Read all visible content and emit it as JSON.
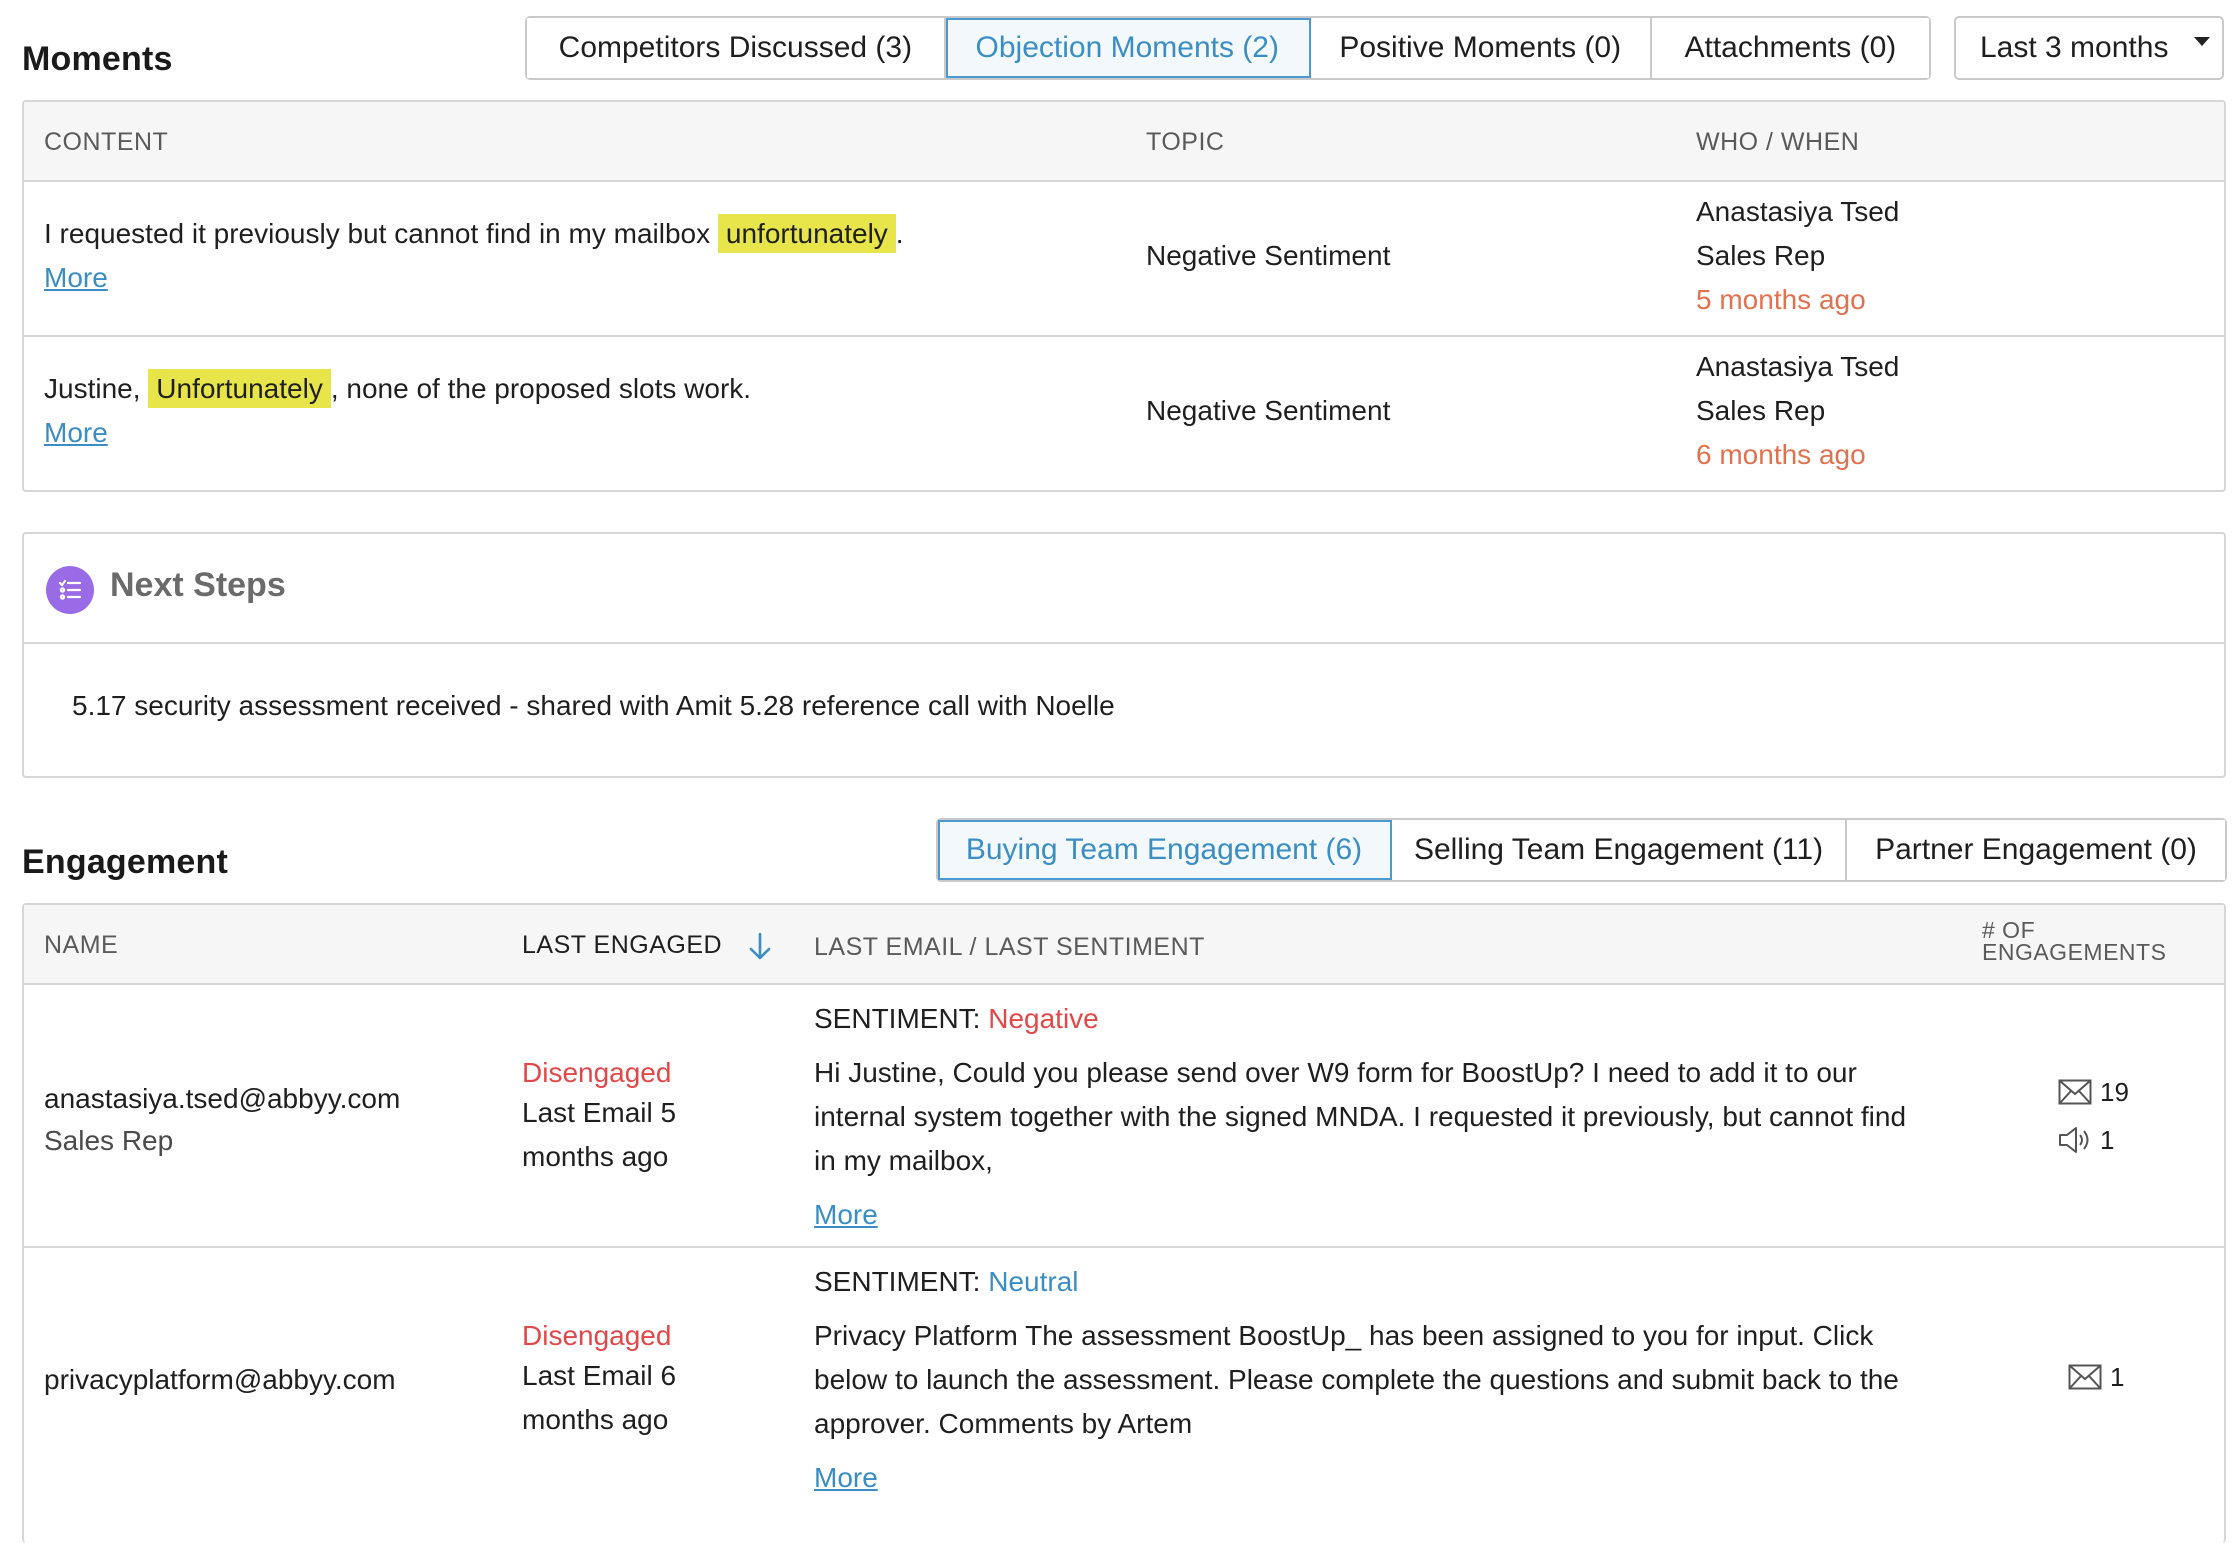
{
  "moments": {
    "title": "Moments",
    "tabs": [
      {
        "label": "Competitors Discussed (3)",
        "active": false
      },
      {
        "label": "Objection Moments (2)",
        "active": true
      },
      {
        "label": "Positive Moments (0)",
        "active": false
      },
      {
        "label": "Attachments (0)",
        "active": false
      }
    ],
    "range_dropdown": "Last 3 months",
    "columns": {
      "content": "CONTENT",
      "topic": "TOPIC",
      "who": "WHO / WHEN"
    },
    "rows": [
      {
        "content_before": "I requested it previously but cannot find in my mailbox ",
        "content_highlight": "unfortunately",
        "content_after": ".",
        "more": "More",
        "topic": "Negative Sentiment",
        "who_name": "Anastasiya Tsed",
        "who_role": "Sales Rep",
        "when": "5 months ago"
      },
      {
        "content_before": "Justine, ",
        "content_highlight": "Unfortunately",
        "content_after": ", none of the proposed slots work.",
        "more": "More",
        "topic": "Negative Sentiment",
        "who_name": "Anastasiya Tsed",
        "who_role": "Sales Rep",
        "when": "6 months ago"
      }
    ]
  },
  "next_steps": {
    "title": "Next Steps",
    "icon": "checklist-icon",
    "icon_color": "#9a6be6",
    "text": "5.17 security assessment received - shared with Amit 5.28 reference call with Noelle"
  },
  "engagement": {
    "title": "Engagement",
    "tabs": [
      {
        "label": "Buying Team Engagement (6)",
        "active": true
      },
      {
        "label": "Selling Team Engagement (11)",
        "active": false
      },
      {
        "label": "Partner Engagement (0)",
        "active": false
      }
    ],
    "columns": {
      "name": "NAME",
      "last_engaged": "LAST ENGAGED",
      "last_email": "LAST EMAIL / LAST SENTIMENT",
      "num_engagements_line1": "# OF",
      "num_engagements_line2": "ENGAGEMENTS"
    },
    "rows": [
      {
        "email": "anastasiya.tsed@abbyy.com",
        "role": "Sales Rep",
        "status": "Disengaged",
        "last_email_line1": "Last Email 5",
        "last_email_line2": "months ago",
        "sentiment_label": "SENTIMENT: ",
        "sentiment_value": "Negative",
        "sentiment_color": "#e34848",
        "snippet_line1": "Hi Justine, Could you please send over W9 form for BoostUp? I need to add it to our",
        "snippet_line2": "internal system together with the signed MNDA. I requested it previously, but cannot find",
        "snippet_line3": "in my mailbox,",
        "more": "More",
        "email_count": "19",
        "call_count": "1"
      },
      {
        "email": "privacyplatform@abbyy.com",
        "role": "",
        "status": "Disengaged",
        "last_email_line1": "Last Email 6",
        "last_email_line2": "months ago",
        "sentiment_label": "SENTIMENT: ",
        "sentiment_value": "Neutral",
        "sentiment_color": "#3b8ec4",
        "snippet_line1": "Privacy Platform The assessment BoostUp_ has been assigned to you for input. Click",
        "snippet_line2": "below to launch the assessment. Please complete the questions and submit back to the",
        "snippet_line3": "approver. Comments by Artem",
        "more": "More",
        "email_count": "1"
      }
    ]
  }
}
